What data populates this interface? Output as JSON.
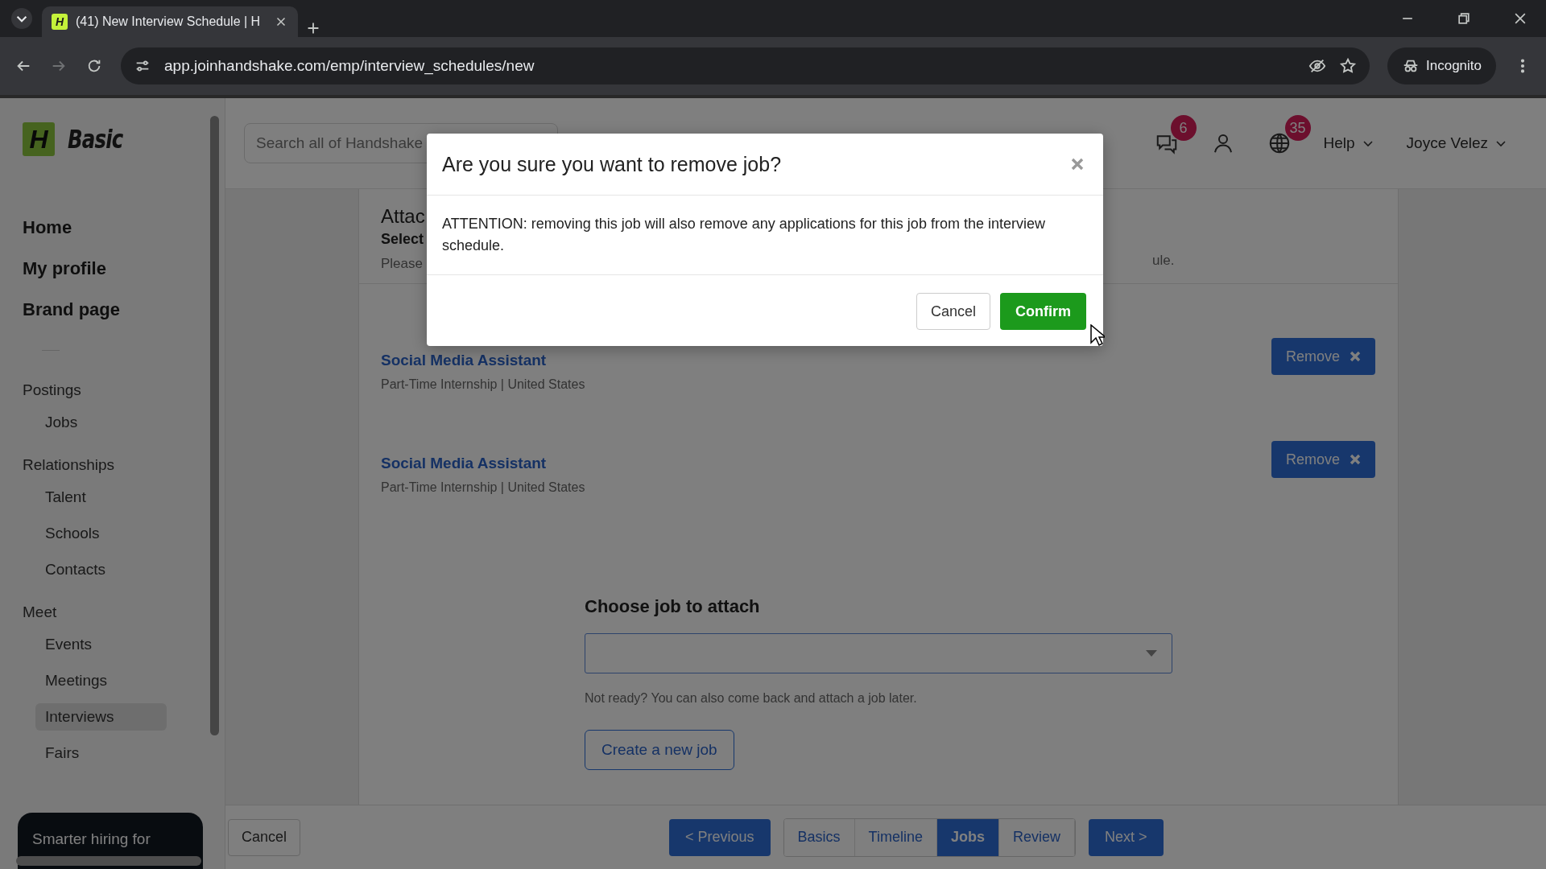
{
  "browser": {
    "tab_title": "(41) New Interview Schedule | H",
    "favicon_letter": "H",
    "url": "app.joinhandshake.com/emp/interview_schedules/new",
    "profile_label": "Incognito"
  },
  "sidebar": {
    "logo_letter": "H",
    "logo_text": "Basic",
    "nav": [
      {
        "label": "Home",
        "selected": false
      },
      {
        "label": "My profile",
        "selected": false
      },
      {
        "label": "Brand page",
        "selected": false
      }
    ],
    "sections": [
      {
        "title": "Postings",
        "items": [
          {
            "label": "Jobs",
            "selected": false
          }
        ]
      },
      {
        "title": "Relationships",
        "items": [
          {
            "label": "Talent",
            "selected": false
          },
          {
            "label": "Schools",
            "selected": false
          },
          {
            "label": "Contacts",
            "selected": false
          }
        ]
      },
      {
        "title": "Meet",
        "items": [
          {
            "label": "Events",
            "selected": false
          },
          {
            "label": "Meetings",
            "selected": false
          },
          {
            "label": "Interviews",
            "selected": true
          },
          {
            "label": "Fairs",
            "selected": false
          }
        ]
      }
    ],
    "promo": "Smarter hiring for"
  },
  "header": {
    "search_placeholder": "Search all of Handshake",
    "messages_badge": "6",
    "notifications_badge": "35",
    "help": "Help",
    "user": "Joyce Velez"
  },
  "content": {
    "heading": "Attac",
    "subheading": "Select",
    "note": "Please",
    "note_end": "ule.",
    "jobs": [
      {
        "title": "Social Media Assistant",
        "subtitle": "Part-Time Internship | United States",
        "button": "Remove"
      },
      {
        "title": "Social Media Assistant",
        "subtitle": "Part-Time Internship | United States",
        "button": "Remove"
      }
    ],
    "choose_label": "Choose job to attach",
    "hint": "Not ready? You can also come back and attach a job later.",
    "create_button": "Create a new job"
  },
  "footer": {
    "cancel": "Cancel",
    "previous": "< Previous",
    "steps": [
      {
        "label": "Basics",
        "selected": false
      },
      {
        "label": "Timeline",
        "selected": false
      },
      {
        "label": "Jobs",
        "selected": true
      },
      {
        "label": "Review",
        "selected": false
      }
    ],
    "next": "Next >"
  },
  "dialog": {
    "title": "Are you sure you want to remove job?",
    "message": "ATTENTION: removing this job will also remove any applications for this job from the interview schedule.",
    "cancel": "Cancel",
    "confirm": "Confirm"
  }
}
